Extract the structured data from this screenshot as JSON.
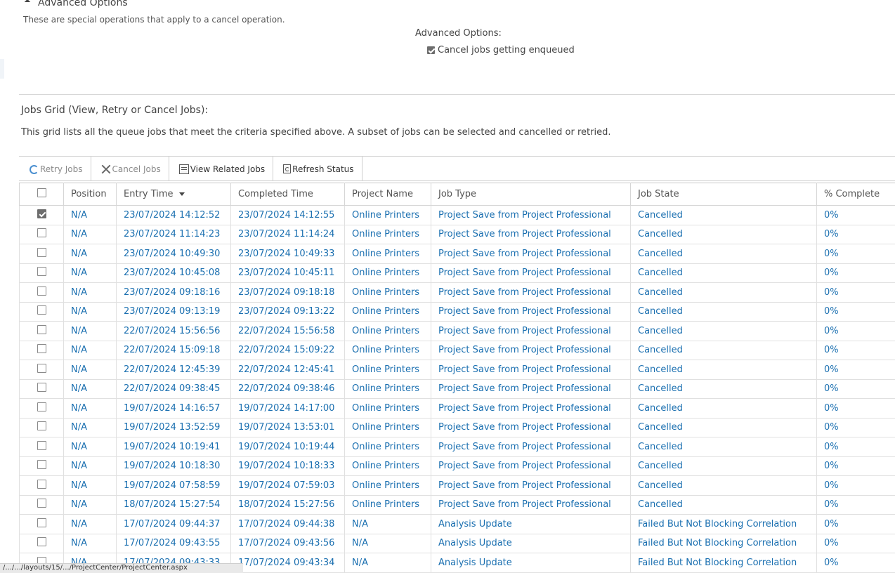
{
  "advanced": {
    "header": "Advanced Options",
    "description": "These are special operations that apply to a cancel operation.",
    "options_label": "Advanced Options:",
    "cancel_enqueued_label": "Cancel jobs getting enqueued",
    "cancel_enqueued_checked": true
  },
  "grid": {
    "title": "Jobs Grid (View, Retry or Cancel Jobs):",
    "description": "This grid lists all the queue jobs that meet the criteria specified above. A subset of jobs can be selected and cancelled or retried.",
    "toolbar": {
      "retry": "Retry Jobs",
      "cancel": "Cancel Jobs",
      "view_related": "View Related Jobs",
      "refresh": "Refresh Status"
    },
    "columns": [
      "Position",
      "Entry Time",
      "Completed Time",
      "Project Name",
      "Job Type",
      "Job State",
      "% Complete"
    ],
    "sort_column": "Entry Time",
    "rows": [
      {
        "checked": true,
        "position": "N/A",
        "entry": "23/07/2024 14:12:52",
        "completed": "23/07/2024 14:12:55",
        "project": "Online Printers",
        "type": "Project Save from Project Professional",
        "state": "Cancelled",
        "pct": "0%"
      },
      {
        "checked": false,
        "position": "N/A",
        "entry": "23/07/2024 11:14:23",
        "completed": "23/07/2024 11:14:24",
        "project": "Online Printers",
        "type": "Project Save from Project Professional",
        "state": "Cancelled",
        "pct": "0%"
      },
      {
        "checked": false,
        "position": "N/A",
        "entry": "23/07/2024 10:49:30",
        "completed": "23/07/2024 10:49:33",
        "project": "Online Printers",
        "type": "Project Save from Project Professional",
        "state": "Cancelled",
        "pct": "0%"
      },
      {
        "checked": false,
        "position": "N/A",
        "entry": "23/07/2024 10:45:08",
        "completed": "23/07/2024 10:45:11",
        "project": "Online Printers",
        "type": "Project Save from Project Professional",
        "state": "Cancelled",
        "pct": "0%"
      },
      {
        "checked": false,
        "position": "N/A",
        "entry": "23/07/2024 09:18:16",
        "completed": "23/07/2024 09:18:18",
        "project": "Online Printers",
        "type": "Project Save from Project Professional",
        "state": "Cancelled",
        "pct": "0%"
      },
      {
        "checked": false,
        "position": "N/A",
        "entry": "23/07/2024 09:13:19",
        "completed": "23/07/2024 09:13:22",
        "project": "Online Printers",
        "type": "Project Save from Project Professional",
        "state": "Cancelled",
        "pct": "0%"
      },
      {
        "checked": false,
        "position": "N/A",
        "entry": "22/07/2024 15:56:56",
        "completed": "22/07/2024 15:56:58",
        "project": "Online Printers",
        "type": "Project Save from Project Professional",
        "state": "Cancelled",
        "pct": "0%"
      },
      {
        "checked": false,
        "position": "N/A",
        "entry": "22/07/2024 15:09:18",
        "completed": "22/07/2024 15:09:22",
        "project": "Online Printers",
        "type": "Project Save from Project Professional",
        "state": "Cancelled",
        "pct": "0%"
      },
      {
        "checked": false,
        "position": "N/A",
        "entry": "22/07/2024 12:45:39",
        "completed": "22/07/2024 12:45:41",
        "project": "Online Printers",
        "type": "Project Save from Project Professional",
        "state": "Cancelled",
        "pct": "0%"
      },
      {
        "checked": false,
        "position": "N/A",
        "entry": "22/07/2024 09:38:45",
        "completed": "22/07/2024 09:38:46",
        "project": "Online Printers",
        "type": "Project Save from Project Professional",
        "state": "Cancelled",
        "pct": "0%"
      },
      {
        "checked": false,
        "position": "N/A",
        "entry": "19/07/2024 14:16:57",
        "completed": "19/07/2024 14:17:00",
        "project": "Online Printers",
        "type": "Project Save from Project Professional",
        "state": "Cancelled",
        "pct": "0%"
      },
      {
        "checked": false,
        "position": "N/A",
        "entry": "19/07/2024 13:52:59",
        "completed": "19/07/2024 13:53:01",
        "project": "Online Printers",
        "type": "Project Save from Project Professional",
        "state": "Cancelled",
        "pct": "0%"
      },
      {
        "checked": false,
        "position": "N/A",
        "entry": "19/07/2024 10:19:41",
        "completed": "19/07/2024 10:19:44",
        "project": "Online Printers",
        "type": "Project Save from Project Professional",
        "state": "Cancelled",
        "pct": "0%"
      },
      {
        "checked": false,
        "position": "N/A",
        "entry": "19/07/2024 10:18:30",
        "completed": "19/07/2024 10:18:33",
        "project": "Online Printers",
        "type": "Project Save from Project Professional",
        "state": "Cancelled",
        "pct": "0%"
      },
      {
        "checked": false,
        "position": "N/A",
        "entry": "19/07/2024 07:58:59",
        "completed": "19/07/2024 07:59:03",
        "project": "Online Printers",
        "type": "Project Save from Project Professional",
        "state": "Cancelled",
        "pct": "0%"
      },
      {
        "checked": false,
        "position": "N/A",
        "entry": "18/07/2024 15:27:54",
        "completed": "18/07/2024 15:27:56",
        "project": "Online Printers",
        "type": "Project Save from Project Professional",
        "state": "Cancelled",
        "pct": "0%"
      },
      {
        "checked": false,
        "position": "N/A",
        "entry": "17/07/2024 09:44:37",
        "completed": "17/07/2024 09:44:38",
        "project": "N/A",
        "type": "Analysis Update",
        "state": "Failed But Not Blocking Correlation",
        "pct": "0%"
      },
      {
        "checked": false,
        "position": "N/A",
        "entry": "17/07/2024 09:43:55",
        "completed": "17/07/2024 09:43:56",
        "project": "N/A",
        "type": "Analysis Update",
        "state": "Failed But Not Blocking Correlation",
        "pct": "0%"
      },
      {
        "checked": false,
        "position": "N/A",
        "entry": "17/07/2024 09:43:33",
        "completed": "17/07/2024 09:43:34",
        "project": "N/A",
        "type": "Analysis Update",
        "state": "Failed But Not Blocking Correlation",
        "pct": "0%"
      }
    ]
  },
  "status_bar": {
    "url": "/.../.../layouts/15/.../ProjectCenter/ProjectCenter.aspx"
  },
  "colors": {
    "link": "#1a6fb0",
    "text": "#444444",
    "border": "#d6d6d6"
  }
}
